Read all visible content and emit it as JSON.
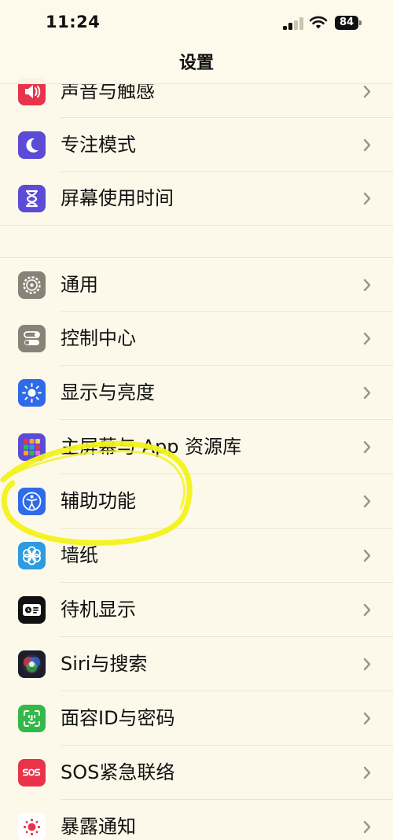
{
  "status_bar": {
    "time": "11:24",
    "battery": "84",
    "icons": [
      "cellular-signal-icon",
      "wifi-icon",
      "battery-icon"
    ]
  },
  "nav": {
    "title": "设置"
  },
  "groups": [
    {
      "items": [
        {
          "label": "声音与触感",
          "icon": "speaker-icon",
          "color": "#e8334a"
        },
        {
          "label": "专注模式",
          "icon": "moon-icon",
          "color": "#5c4bd6"
        },
        {
          "label": "屏幕使用时间",
          "icon": "hourglass-icon",
          "color": "#5c4bd6"
        }
      ]
    },
    {
      "items": [
        {
          "label": "通用",
          "icon": "gear-icon",
          "color": "#8a8276"
        },
        {
          "label": "控制中心",
          "icon": "toggles-icon",
          "color": "#8a8276"
        },
        {
          "label": "显示与亮度",
          "icon": "sun-icon",
          "color": "#2f6ae8"
        },
        {
          "label": "主屏幕与 App 资源库",
          "icon": "home-screen-grid-icon",
          "color": "#5c4bd6"
        },
        {
          "label": "辅助功能",
          "icon": "accessibility-icon",
          "color": "#2f6ae8"
        },
        {
          "label": "墙纸",
          "icon": "wallpaper-flower-icon",
          "color": "#2c9be0"
        },
        {
          "label": "待机显示",
          "icon": "standby-icon",
          "color": "#111111"
        },
        {
          "label": "Siri与搜索",
          "icon": "siri-icon",
          "color": "#2a2a3a"
        },
        {
          "label": "面容ID与密码",
          "icon": "face-id-icon",
          "color": "#34b84a"
        },
        {
          "label": "SOS紧急联络",
          "icon": "sos-icon",
          "color": "#e8334a"
        },
        {
          "label": "暴露通知",
          "icon": "exposure-icon",
          "color": "#ffffff"
        }
      ]
    }
  ],
  "colors": {
    "background": "#fdf9ea",
    "separator": "#ebe5cf",
    "chevron": "#9a958a",
    "annotation_highlight": "#f2f21a"
  }
}
